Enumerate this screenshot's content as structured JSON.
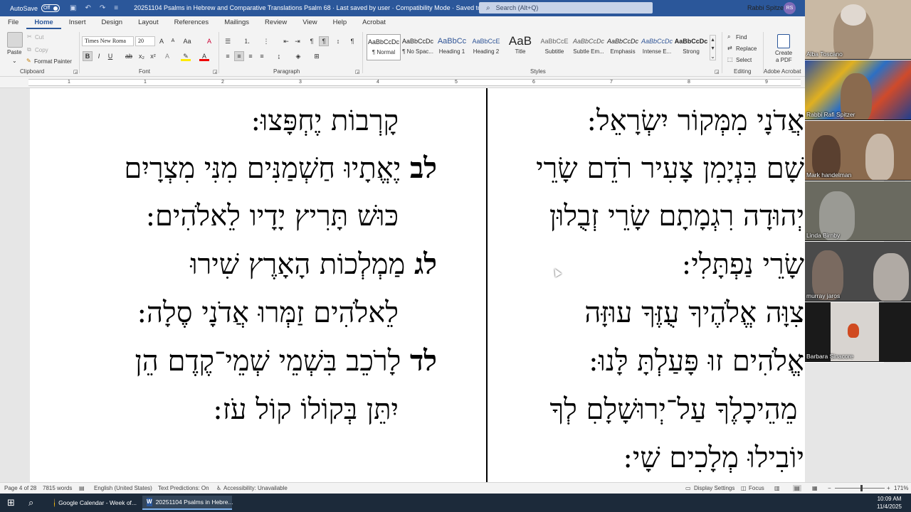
{
  "titlebar": {
    "autosave_label": "AutoSave",
    "autosave_state": "Off",
    "doc_title": "20251104 Psalms in Hebrew and Comparative Translations Psalm 68  ·  Last saved by user  ·  Compatibility Mode  ·  Saved to this PC ⌄",
    "search_placeholder": "Search (Alt+Q)",
    "user_name": "Rabbi Spitzer",
    "user_initials": "RS"
  },
  "ribbon_tabs": [
    "File",
    "Home",
    "Insert",
    "Design",
    "Layout",
    "References",
    "Mailings",
    "Review",
    "View",
    "Help",
    "Acrobat"
  ],
  "clipboard": {
    "paste": "Paste",
    "cut": "Cut",
    "copy": "Copy",
    "format_painter": "Format Painter",
    "label": "Clipboard"
  },
  "font": {
    "family": "Times New Roma",
    "size": "20",
    "label": "Font",
    "bold": "B",
    "italic": "I",
    "underline": "U"
  },
  "paragraph": {
    "label": "Paragraph"
  },
  "styles": {
    "label": "Styles",
    "items": [
      {
        "preview": "AaBbCcDc",
        "name": "¶ Normal"
      },
      {
        "preview": "AaBbCcDc",
        "name": "¶ No Spac..."
      },
      {
        "preview": "AaBbCc",
        "name": "Heading 1"
      },
      {
        "preview": "AaBbCcE",
        "name": "Heading 2"
      },
      {
        "preview": "AaB",
        "name": "Title"
      },
      {
        "preview": "AaBbCcE",
        "name": "Subtitle"
      },
      {
        "preview": "AaBbCcDc",
        "name": "Subtle Em..."
      },
      {
        "preview": "AaBbCcDc",
        "name": "Emphasis"
      },
      {
        "preview": "AaBbCcDc",
        "name": "Intense E..."
      },
      {
        "preview": "AaBbCcDc",
        "name": "Strong"
      }
    ]
  },
  "editing": {
    "label": "Editing",
    "find": "Find",
    "replace": "Replace",
    "select": "Select"
  },
  "acrobat": {
    "create_pdf_line1": "Create",
    "create_pdf_line2": "a PDF",
    "label": "Adobe Acrobat"
  },
  "ruler_numbers": [
    "1",
    "1",
    "2",
    "3",
    "4",
    "5",
    "6",
    "7",
    "8",
    "9"
  ],
  "document": {
    "left_column": [
      {
        "num": "",
        "text": "קָרְבוֹת יֶחְפָּצוּ:"
      },
      {
        "num": "לב",
        "text": "יֶאֱתָיוּ חַשְׁמַנִּים מִנִּי מִצְרָיִם"
      },
      {
        "num": "",
        "text": "כּוּשׁ תָּרִיץ יָדָיו לֵאלֹהִים:"
      },
      {
        "num": "לג",
        "text": "מַמְלְכוֹת הָאָרֶץ שִׁירוּ"
      },
      {
        "num": "",
        "text": "לֵאלֹהִים זַמְּרוּ אֲדֹנָי סֶלָה:"
      },
      {
        "num": "לד",
        "text": "לָרֹכֵב בִּשְׁמֵי שְׁמֵי־קֶדֶם הֵן"
      },
      {
        "num": "",
        "text": "יִתֵּן בְּקוֹלוֹ קוֹל עֹז:"
      }
    ],
    "right_column": [
      {
        "num": "",
        "text": "אֲדֹנָי מִמְּקוֹר יִשְׂרָאֵל:"
      },
      {
        "num": "",
        "text": "שָׁם בִּנְיָמִן  צָעִיר רֹדֵם שָׂרֵי"
      },
      {
        "num": "",
        "text": "יְהוּדָה רִגְמָתָם שָׂרֵי זְבֻלוּן"
      },
      {
        "num": "",
        "text": "שָׂרֵי נַפְתָּלִי:"
      },
      {
        "num": "",
        "text": "צִוָּה אֱלֹהֶיךָ עֻזֶּךָ עוּזָּה"
      },
      {
        "num": "",
        "text": "אֱלֹהִים זוּ פָּעַלְתָּ לָּנוּ:"
      },
      {
        "num": "ל",
        "text": "מֵהֵיכָלֶךָ עַל־יְרוּשָׁלָםִ לְךָ"
      },
      {
        "num": "",
        "text": "יוֹבִילוּ מְלָכִים שָׁי:"
      }
    ]
  },
  "statusbar": {
    "page": "Page 4 of 28",
    "words": "7815 words",
    "language": "English (United States)",
    "predictions": "Text Predictions: On",
    "accessibility": "Accessibility: Unavailable",
    "display_settings": "Display Settings",
    "focus": "Focus",
    "zoom": "171%"
  },
  "taskbar": {
    "chrome_item": "Google Calendar - Week of...",
    "word_item": "20251104 Psalms in Hebre...",
    "time": "10:09 AM",
    "date": "11/4/2025"
  },
  "participants": [
    {
      "name": "Alba Toscano",
      "bg": "#c9b9a4"
    },
    {
      "name": "Rabbi Rafi Spitzer",
      "bg": "#3a5fa8"
    },
    {
      "name": "Mark handelman",
      "bg": "#8a6a4e"
    },
    {
      "name": "Linda Birnby",
      "bg": "#6a6a60"
    },
    {
      "name": "murray jaros",
      "bg": "#4a4a4a"
    },
    {
      "name": "Barbara Sinacore",
      "bg": "#1a1a1a"
    }
  ]
}
